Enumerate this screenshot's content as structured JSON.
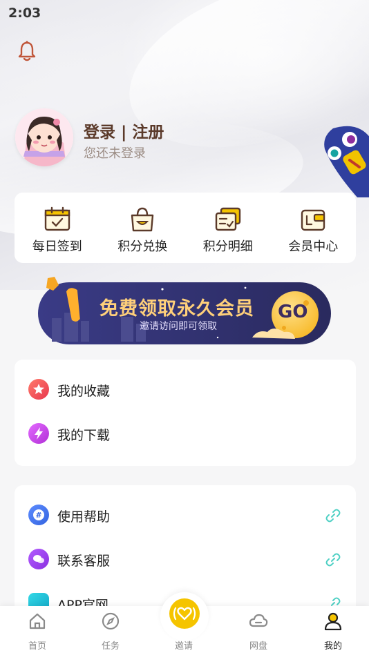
{
  "status_bar": {
    "time": "2:03"
  },
  "profile": {
    "title": "登录 | 注册",
    "subtitle": "您还未登录"
  },
  "quick_actions": [
    {
      "label": "每日签到",
      "icon": "calendar-check-icon"
    },
    {
      "label": "积分兑换",
      "icon": "shopping-bag-icon"
    },
    {
      "label": "积分明细",
      "icon": "points-detail-icon"
    },
    {
      "label": "会员中心",
      "icon": "wallet-icon"
    }
  ],
  "banner": {
    "title": "免费领取永久会员",
    "subtitle": "邀请访问即可领取",
    "go": "GO"
  },
  "list1": [
    {
      "label": "我的收藏",
      "icon": "star-icon"
    },
    {
      "label": "我的下载",
      "icon": "lightning-icon"
    }
  ],
  "list2": [
    {
      "label": "使用帮助",
      "icon": "hash-icon"
    },
    {
      "label": "联系客服",
      "icon": "chat-icon"
    },
    {
      "label": "APP官网",
      "icon": "app-icon"
    }
  ],
  "tabs": [
    {
      "label": "首页",
      "icon": "home-icon"
    },
    {
      "label": "任务",
      "icon": "compass-icon"
    },
    {
      "label": "邀请",
      "icon": "invite-heart-icon"
    },
    {
      "label": "网盘",
      "icon": "cloud-icon"
    },
    {
      "label": "我的",
      "icon": "user-icon",
      "active": true
    }
  ],
  "colors": {
    "accent": "#f5c400",
    "brown": "#5b3a2a",
    "banner_bg": "#2e2f6b",
    "link": "#4fd0c4"
  }
}
